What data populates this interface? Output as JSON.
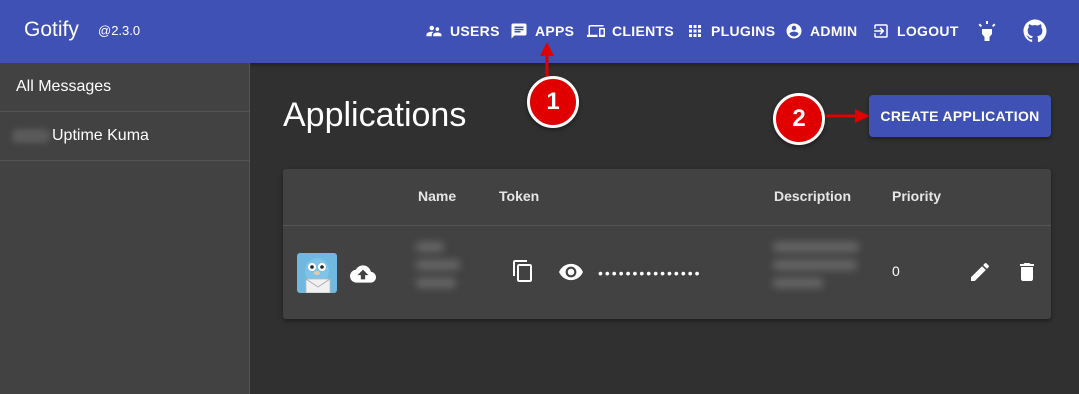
{
  "app": {
    "title": "Gotify",
    "version": "@2.3.0"
  },
  "nav": {
    "users": "USERS",
    "apps": "APPS",
    "clients": "CLIENTS",
    "plugins": "PLUGINS",
    "admin": "ADMIN",
    "logout": "LOGOUT"
  },
  "sidebar": {
    "items": [
      {
        "label": "All Messages"
      },
      {
        "label": "Uptime Kuma"
      }
    ]
  },
  "main": {
    "title": "Applications",
    "create_button": "CREATE APPLICATION",
    "table": {
      "headers": {
        "name": "Name",
        "token": "Token",
        "description": "Description",
        "priority": "Priority"
      },
      "rows": [
        {
          "token_masked": "•••••••••••••••",
          "priority": "0"
        }
      ]
    }
  },
  "annotations": {
    "badge1": "1",
    "badge2": "2"
  },
  "colors": {
    "primary": "#3f51b5",
    "background": "#303030",
    "surface": "#424242",
    "annotation": "#e00000"
  }
}
